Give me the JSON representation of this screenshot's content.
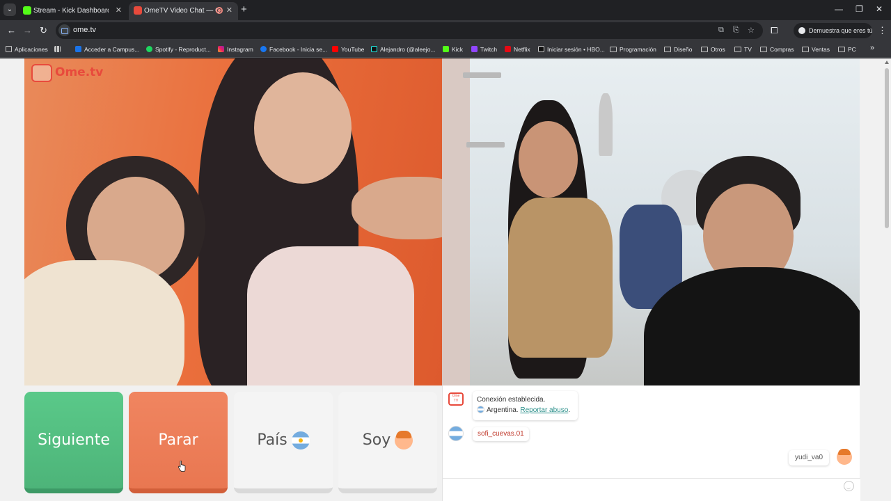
{
  "browser": {
    "tabs": [
      {
        "title": "Stream - Kick Dashboard",
        "active": false,
        "favicon_color": "#53fc18"
      },
      {
        "title": "OmeTV Video Chat — Ome",
        "active": true,
        "favicon_color": "#e84a3c"
      }
    ],
    "url": "ome.tv",
    "profile_label": "Demuestra que eres tú",
    "bookmarks": [
      {
        "label": "Aplicaciones",
        "icon": "grid-icon"
      },
      {
        "label": "Acceder a Campus...",
        "icon": "campus-icon"
      },
      {
        "label": "Spotify - Reproduct...",
        "icon": "spotify-icon"
      },
      {
        "label": "Instagram",
        "icon": "instagram-icon"
      },
      {
        "label": "Facebook - Inicia se...",
        "icon": "facebook-icon"
      },
      {
        "label": "YouTube",
        "icon": "youtube-icon"
      },
      {
        "label": "Alejandro (@aleejo...",
        "icon": "tiktok-icon"
      },
      {
        "label": "Kick",
        "icon": "kick-icon"
      },
      {
        "label": "Twitch",
        "icon": "twitch-icon"
      },
      {
        "label": "Netflix",
        "icon": "netflix-icon"
      },
      {
        "label": "Iniciar sesión • HBO...",
        "icon": "hbo-icon"
      },
      {
        "label": "Programación",
        "icon": "folder-icon"
      },
      {
        "label": "Diseño",
        "icon": "folder-icon"
      },
      {
        "label": "Otros",
        "icon": "folder-icon"
      },
      {
        "label": "TV",
        "icon": "folder-icon"
      },
      {
        "label": "Compras",
        "icon": "folder-icon"
      },
      {
        "label": "Ventas",
        "icon": "folder-icon"
      },
      {
        "label": "PC",
        "icon": "folder-icon"
      }
    ]
  },
  "app": {
    "logo_text": "Ome.tv",
    "buttons": {
      "next": "Siguiente",
      "stop": "Parar",
      "country": "País",
      "gender": "Soy"
    },
    "chat": {
      "system_line1": "Conexión establecida.",
      "system_country": "Argentina.",
      "report_link": "Reportar abuso",
      "report_suffix": ".",
      "peer_username": "sofi_cuevas.01",
      "self_username": "yudi_va0"
    },
    "colors": {
      "next_button": "#5ac989",
      "stop_button": "#f08560",
      "brand_red": "#e84a3c",
      "report_link": "#2a8f8a"
    }
  }
}
